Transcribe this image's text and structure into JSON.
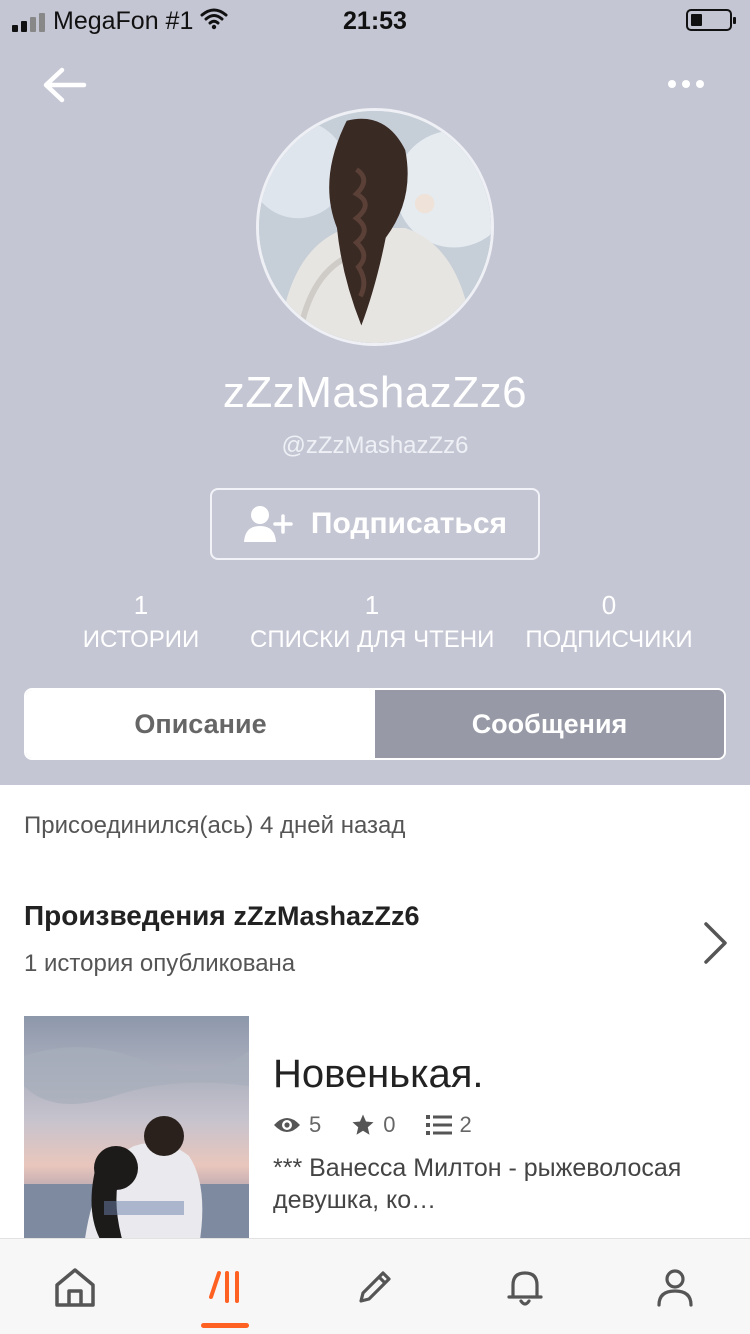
{
  "status_bar": {
    "carrier": "MegaFon #1",
    "time": "21:53"
  },
  "header": {
    "back_icon": "arrow-left-icon",
    "more_icon": "ellipsis-icon"
  },
  "profile": {
    "display_name": "zZzMashazZz6",
    "username": "@zZzMashazZz6",
    "follow_label": "Подписаться",
    "follow_icon": "add-user-icon"
  },
  "stats": [
    {
      "value": "1",
      "label": "ИСТОРИИ"
    },
    {
      "value": "1",
      "label": "СПИСКИ ДЛЯ ЧТЕНИЯ"
    },
    {
      "value": "0",
      "label": "ПОДПИСЧИКИ"
    }
  ],
  "tabs": [
    {
      "label": "Описание",
      "active": true
    },
    {
      "label": "Сообщения",
      "active": false
    }
  ],
  "about": {
    "joined": "Присоединился(ась) 4 дней назад"
  },
  "works": {
    "title_prefix": "Произведения",
    "title_user": "zZzMashazZz6",
    "subtitle": "1 история опубликована",
    "stories": [
      {
        "title": "Новенькая.",
        "views": "5",
        "votes": "0",
        "parts": "2",
        "description": "*** Ванесса Милтон - рыжеволосая девушка, ко…"
      }
    ]
  },
  "bottom_nav": [
    {
      "name": "home",
      "icon": "home-icon"
    },
    {
      "name": "library",
      "icon": "wattpad-logo-icon",
      "active": true
    },
    {
      "name": "write",
      "icon": "pencil-icon"
    },
    {
      "name": "notifications",
      "icon": "bell-icon"
    },
    {
      "name": "profile",
      "icon": "person-icon"
    }
  ],
  "colors": {
    "header_bg": "#c4c6d3",
    "accent": "#ff6122",
    "inactive_tab": "#979aa6"
  }
}
